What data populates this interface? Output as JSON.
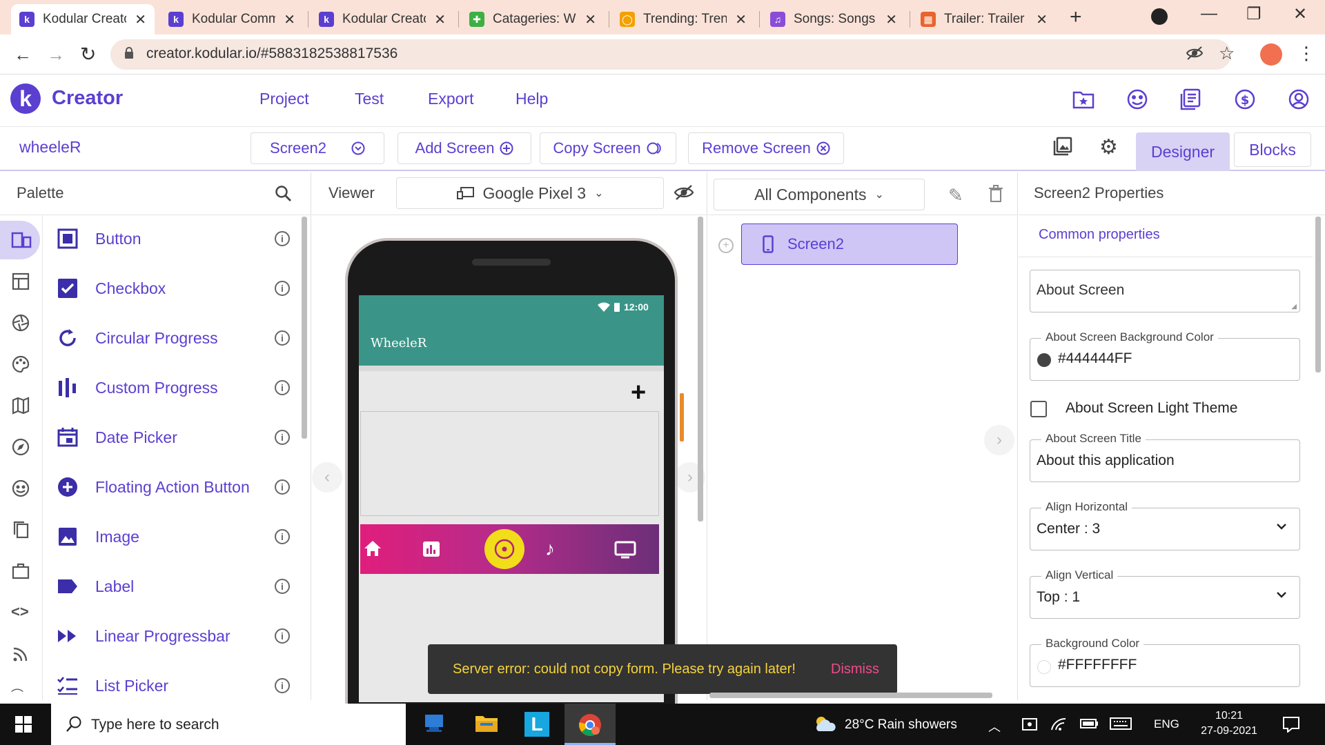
{
  "browser": {
    "tabs": [
      {
        "title": "Kodular Creator",
        "favicon_color": "#5b3fd1",
        "favicon_glyph": "k"
      },
      {
        "title": "Kodular Community",
        "favicon_color": "#5b3fd1",
        "favicon_glyph": "k"
      },
      {
        "title": "Kodular Creator",
        "favicon_color": "#5b3fd1",
        "favicon_glyph": "k"
      },
      {
        "title": "Catageries: Wh",
        "favicon_color": "#3cb043",
        "favicon_glyph": "✚"
      },
      {
        "title": "Trending: Trend",
        "favicon_color": "#f2a100",
        "favicon_glyph": "◯"
      },
      {
        "title": "Songs: Songs V",
        "favicon_color": "#8b4dd8",
        "favicon_glyph": "♫"
      },
      {
        "title": "Trailer: Trailer w",
        "favicon_color": "#e8642c",
        "favicon_glyph": "▦"
      }
    ],
    "new_tab": "+",
    "url": "creator.kodular.io/#5883182538817536"
  },
  "app": {
    "brand": "Creator",
    "logo_glyph": "k",
    "menu": [
      "Project",
      "Test",
      "Export",
      "Help"
    ],
    "project_name": "wheeleR",
    "screen_select": "Screen2",
    "add_screen": "Add Screen",
    "copy_screen": "Copy Screen",
    "remove_screen": "Remove Screen",
    "designer": "Designer",
    "blocks": "Blocks",
    "accent": "#5b3fd1"
  },
  "palette": {
    "title": "Palette",
    "items": [
      {
        "label": "Button",
        "icon": "button-icon"
      },
      {
        "label": "Checkbox",
        "icon": "checkbox-icon"
      },
      {
        "label": "Circular Progress",
        "icon": "circular-progress-icon"
      },
      {
        "label": "Custom Progress",
        "icon": "custom-progress-icon"
      },
      {
        "label": "Date Picker",
        "icon": "date-picker-icon"
      },
      {
        "label": "Floating Action Button",
        "icon": "fab-icon"
      },
      {
        "label": "Image",
        "icon": "image-icon"
      },
      {
        "label": "Label",
        "icon": "label-icon"
      },
      {
        "label": "Linear Progressbar",
        "icon": "linear-progressbar-icon"
      },
      {
        "label": "List Picker",
        "icon": "list-picker-icon"
      }
    ]
  },
  "viewer": {
    "title": "Viewer",
    "device": "Google Pixel 3",
    "status_time": "12:00",
    "app_title": "WheeleR",
    "toast_message": "Server error: could not copy form. Please try again later!",
    "toast_action": "Dismiss"
  },
  "components": {
    "filter": "All Components",
    "tree": [
      "Screen2"
    ]
  },
  "properties": {
    "title": "Screen2 Properties",
    "section": "Common properties",
    "about_screen_placeholder": "About Screen",
    "about_bg_label": "About Screen Background Color",
    "about_bg_value": "#444444FF",
    "light_theme_label": "About Screen Light Theme",
    "about_title_label": "About Screen Title",
    "about_title_value": "About this application",
    "align_h_label": "Align Horizontal",
    "align_h_value": "Center : 3",
    "align_v_label": "Align Vertical",
    "align_v_value": "Top : 1",
    "bg_label": "Background Color",
    "bg_value": "#FFFFFFFF"
  },
  "taskbar": {
    "search_placeholder": "Type here to search",
    "weather": "28°C  Rain showers",
    "lang": "ENG",
    "time": "10:21",
    "date": "27-09-2021"
  }
}
